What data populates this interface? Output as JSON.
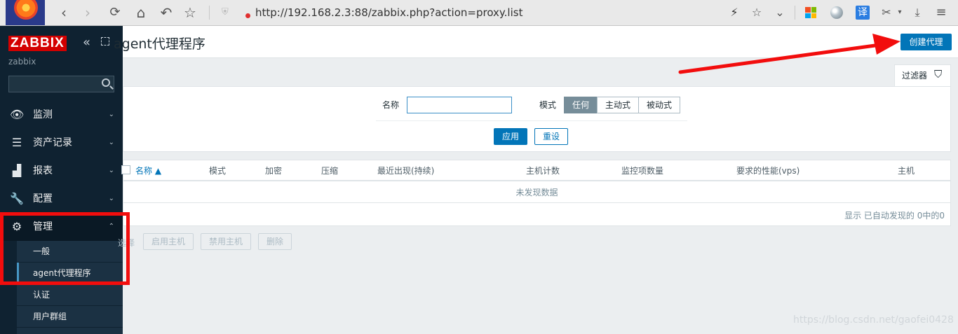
{
  "browser": {
    "url": "http://192.168.2.3:88/zabbix.php?action=proxy.list",
    "back_icon": "‹",
    "forward_icon": "›",
    "reload_icon": "⟳",
    "home_icon": "⌂",
    "undo_icon": "↶",
    "star_icon": "☆",
    "shield_icon": "⛨",
    "lock_icon": "🔒",
    "bolt_icon": "⚡",
    "bookmark_icon": "☆",
    "menu_chevron_icon": "⌄",
    "translate_label": "译",
    "scissors_icon": "✂",
    "dropdown_icon": "▾",
    "download_icon": "⤓",
    "more_icon": "≡"
  },
  "sidebar": {
    "brand": "ZABBIX",
    "collapse_icon": "«",
    "server_name": "zabbix",
    "search_placeholder": "",
    "menu": [
      {
        "label": "监测",
        "icon": "👁"
      },
      {
        "label": "资产记录",
        "icon": "☰"
      },
      {
        "label": "报表",
        "icon": "▟"
      },
      {
        "label": "配置",
        "icon": "🔧"
      },
      {
        "label": "管理",
        "icon": "⚙"
      }
    ],
    "submenu": [
      {
        "label": "一般"
      },
      {
        "label": "agent代理程序"
      },
      {
        "label": "认证"
      },
      {
        "label": "用户群组"
      }
    ],
    "arrow_down": "⌄",
    "arrow_up": "⌃"
  },
  "header": {
    "title": "agent代理程序",
    "create_button": "创建代理"
  },
  "filter": {
    "tab_label": "过滤器",
    "tab_icon": "⛉",
    "name_label": "名称",
    "name_value": "",
    "mode_label": "模式",
    "mode_options": [
      "任何",
      "主动式",
      "被动式"
    ],
    "mode_selected": "任何",
    "apply_button": "应用",
    "reset_button": "重设"
  },
  "table": {
    "columns": [
      "名称 ▲",
      "模式",
      "加密",
      "压缩",
      "最近出现(持续)",
      "主机计数",
      "监控项数量",
      "要求的性能(vps)",
      "主机"
    ],
    "no_data": "未发现数据",
    "stats": "显示 已自动发现的 0中的0"
  },
  "mass_actions": {
    "label": "选择",
    "buttons": [
      "启用主机",
      "禁用主机",
      "删除"
    ]
  },
  "annotations": {
    "highlight_color": "#f20d0d"
  },
  "watermark": "https://blog.csdn.net/gaofei0428",
  "colors": {
    "accent": "#0275b8",
    "sidebar_bg": "#0f2231",
    "brand_red": "#d40000"
  }
}
